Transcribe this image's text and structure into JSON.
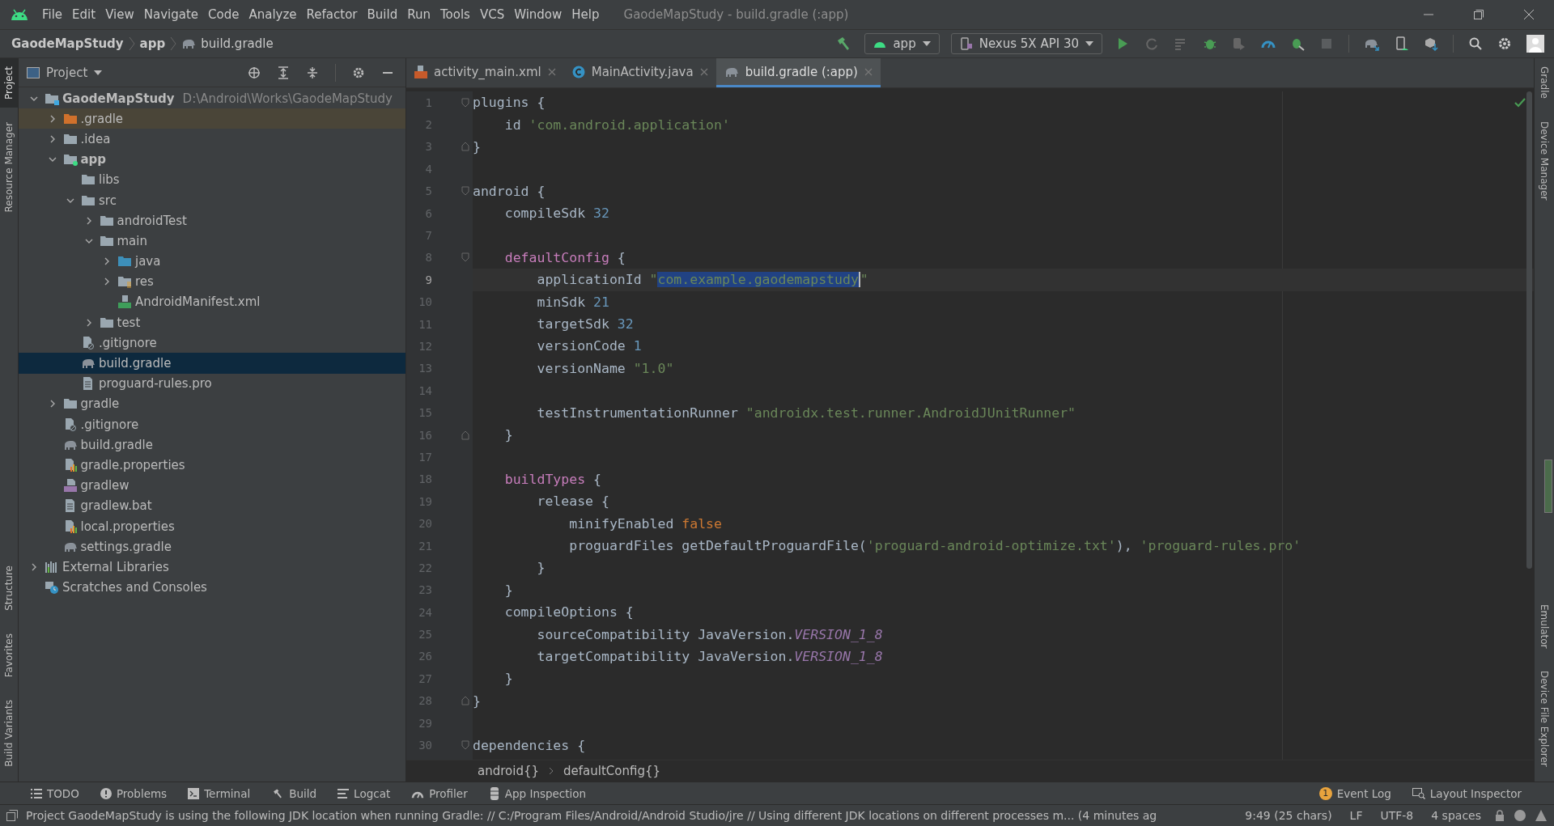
{
  "menu_bar": {
    "items": [
      "File",
      "Edit",
      "View",
      "Navigate",
      "Code",
      "Analyze",
      "Refactor",
      "Build",
      "Run",
      "Tools",
      "VCS",
      "Window",
      "Help"
    ],
    "title": "GaodeMapStudy - build.gradle (:app)"
  },
  "navigation_bar": {
    "breadcrumbs": [
      "GaodeMapStudy",
      "app",
      "build.gradle"
    ],
    "run_config": "app",
    "device": "Nexus 5X API 30"
  },
  "left_tool_tabs": [
    {
      "label": "Project",
      "selected": true,
      "kind": "top"
    },
    {
      "label": "Resource Manager",
      "selected": false,
      "kind": "top"
    },
    {
      "label": "Structure",
      "selected": false,
      "kind": "bottom"
    },
    {
      "label": "Favorites",
      "selected": false,
      "kind": "bottom"
    },
    {
      "label": "Build Variants",
      "selected": false,
      "kind": "bottom"
    }
  ],
  "right_tool_tabs": [
    {
      "label": "Gradle",
      "kind": "top"
    },
    {
      "label": "Device Manager",
      "kind": "top"
    },
    {
      "label": "Emulator",
      "kind": "bottom"
    },
    {
      "label": "Device File Explorer",
      "kind": "bottom"
    }
  ],
  "project_panel": {
    "title": "Project",
    "tree": [
      {
        "name": "GaodeMapStudy",
        "hint": "D:\\Android\\Works\\GaodeMapStudy",
        "kind": "project",
        "expanded": true,
        "selected": false,
        "children": [
          {
            "name": ".gradle",
            "kind": "excluded",
            "expanded": false,
            "selected": false
          },
          {
            "name": ".idea",
            "kind": "folder",
            "expanded": false,
            "selected": false
          },
          {
            "name": "app",
            "kind": "module",
            "expanded": true,
            "selected": false,
            "children": [
              {
                "name": "libs",
                "kind": "folder",
                "selected": false
              },
              {
                "name": "src",
                "kind": "folder",
                "expanded": true,
                "selected": false,
                "children": [
                  {
                    "name": "androidTest",
                    "kind": "folder",
                    "expanded": false,
                    "selected": false
                  },
                  {
                    "name": "main",
                    "kind": "folder",
                    "expanded": true,
                    "selected": false,
                    "children": [
                      {
                        "name": "java",
                        "kind": "source",
                        "expanded": false,
                        "selected": false
                      },
                      {
                        "name": "res",
                        "kind": "res",
                        "expanded": false,
                        "selected": false
                      },
                      {
                        "name": "AndroidManifest.xml",
                        "kind": "manifest",
                        "selected": false
                      }
                    ]
                  },
                  {
                    "name": "test",
                    "kind": "folder",
                    "expanded": false,
                    "selected": false
                  }
                ]
              },
              {
                "name": ".gitignore",
                "kind": "ignore",
                "selected": false
              },
              {
                "name": "build.gradle",
                "kind": "gradle",
                "selected": true
              },
              {
                "name": "proguard-rules.pro",
                "kind": "text",
                "selected": false
              }
            ]
          },
          {
            "name": "gradle",
            "kind": "folder",
            "expanded": false,
            "selected": false
          },
          {
            "name": ".gitignore",
            "kind": "ignore",
            "selected": false
          },
          {
            "name": "build.gradle",
            "kind": "gradle",
            "selected": false
          },
          {
            "name": "gradle.properties",
            "kind": "properties",
            "selected": false
          },
          {
            "name": "gradlew",
            "kind": "shell",
            "selected": false
          },
          {
            "name": "gradlew.bat",
            "kind": "text",
            "selected": false
          },
          {
            "name": "local.properties",
            "kind": "properties",
            "selected": false
          },
          {
            "name": "settings.gradle",
            "kind": "gradle",
            "selected": false
          }
        ]
      },
      {
        "name": "External Libraries",
        "kind": "libraries",
        "expanded": false,
        "selected": false
      },
      {
        "name": "Scratches and Consoles",
        "kind": "scratches",
        "selected": false
      }
    ]
  },
  "editor_tabs": [
    {
      "label": "activity_main.xml",
      "kind": "xml",
      "selected": false
    },
    {
      "label": "MainActivity.java",
      "kind": "java",
      "selected": false
    },
    {
      "label": "build.gradle (:app)",
      "kind": "gradle",
      "selected": true
    }
  ],
  "editor": {
    "lines": [
      {
        "number": "1",
        "kind": "fold_start",
        "current": false,
        "tokens": [
          {
            "text": "plugins {",
            "kind": "plain"
          }
        ]
      },
      {
        "number": "2",
        "current": false,
        "tokens": [
          {
            "text": "    id ",
            "kind": "plain"
          },
          {
            "text": "'com.android.application'",
            "kind": "string"
          }
        ]
      },
      {
        "number": "3",
        "kind": "fold_end",
        "current": false,
        "tokens": [
          {
            "text": "}",
            "kind": "plain"
          }
        ]
      },
      {
        "number": "4",
        "current": false
      },
      {
        "number": "5",
        "kind": "fold_start",
        "current": false,
        "tokens": [
          {
            "text": "android {",
            "kind": "plain"
          }
        ]
      },
      {
        "number": "6",
        "current": false,
        "tokens": [
          {
            "text": "    compileSdk ",
            "kind": "plain"
          },
          {
            "text": "32",
            "kind": "number"
          }
        ]
      },
      {
        "number": "7",
        "current": false
      },
      {
        "number": "8",
        "kind": "fold_start",
        "current": false,
        "tokens": [
          {
            "text": "    defaultConfig",
            "kind": "block"
          },
          {
            "text": " {",
            "kind": "plain"
          }
        ]
      },
      {
        "number": "9",
        "current": true,
        "tokens": [
          {
            "text": "        applicationId ",
            "kind": "plain"
          },
          {
            "text": "\"",
            "kind": "string"
          },
          {
            "text": "com.example.gaodemapstudy",
            "kind": "string",
            "selected": true
          },
          {
            "text": "\"",
            "kind": "string"
          }
        ]
      },
      {
        "number": "10",
        "current": false,
        "tokens": [
          {
            "text": "        minSdk ",
            "kind": "plain"
          },
          {
            "text": "21",
            "kind": "number"
          }
        ]
      },
      {
        "number": "11",
        "current": false,
        "tokens": [
          {
            "text": "        targetSdk ",
            "kind": "plain"
          },
          {
            "text": "32",
            "kind": "number"
          }
        ]
      },
      {
        "number": "12",
        "current": false,
        "tokens": [
          {
            "text": "        versionCode ",
            "kind": "plain"
          },
          {
            "text": "1",
            "kind": "number"
          }
        ]
      },
      {
        "number": "13",
        "current": false,
        "tokens": [
          {
            "text": "        versionName ",
            "kind": "plain"
          },
          {
            "text": "\"1.0\"",
            "kind": "string"
          }
        ]
      },
      {
        "number": "14",
        "current": false
      },
      {
        "number": "15",
        "current": false,
        "tokens": [
          {
            "text": "        testInstrumentationRunner ",
            "kind": "plain"
          },
          {
            "text": "\"androidx.test.runner.AndroidJUnitRunner\"",
            "kind": "string"
          }
        ]
      },
      {
        "number": "16",
        "kind": "fold_end",
        "current": false,
        "tokens": [
          {
            "text": "    }",
            "kind": "plain"
          }
        ]
      },
      {
        "number": "17",
        "current": false
      },
      {
        "number": "18",
        "current": false,
        "tokens": [
          {
            "text": "    buildTypes",
            "kind": "block"
          },
          {
            "text": " {",
            "kind": "plain"
          }
        ]
      },
      {
        "number": "19",
        "current": false,
        "tokens": [
          {
            "text": "        release {",
            "kind": "plain"
          }
        ]
      },
      {
        "number": "20",
        "current": false,
        "tokens": [
          {
            "text": "            minifyEnabled ",
            "kind": "plain"
          },
          {
            "text": "false",
            "kind": "keyword"
          }
        ]
      },
      {
        "number": "21",
        "current": false,
        "tokens": [
          {
            "text": "            proguardFiles getDefaultProguardFile(",
            "kind": "plain"
          },
          {
            "text": "'proguard-android-optimize.txt'",
            "kind": "string"
          },
          {
            "text": "), ",
            "kind": "plain"
          },
          {
            "text": "'proguard-rules.pro'",
            "kind": "string"
          }
        ]
      },
      {
        "number": "22",
        "current": false,
        "tokens": [
          {
            "text": "        }",
            "kind": "plain"
          }
        ]
      },
      {
        "number": "23",
        "current": false,
        "tokens": [
          {
            "text": "    }",
            "kind": "plain"
          }
        ]
      },
      {
        "number": "24",
        "current": false,
        "tokens": [
          {
            "text": "    compileOptions {",
            "kind": "plain"
          }
        ]
      },
      {
        "number": "25",
        "current": false,
        "tokens": [
          {
            "text": "        sourceCompatibility JavaVersion.",
            "kind": "plain"
          },
          {
            "text": "VERSION_1_8",
            "kind": "constant"
          }
        ]
      },
      {
        "number": "26",
        "current": false,
        "tokens": [
          {
            "text": "        targetCompatibility JavaVersion.",
            "kind": "plain"
          },
          {
            "text": "VERSION_1_8",
            "kind": "constant"
          }
        ]
      },
      {
        "number": "27",
        "current": false,
        "tokens": [
          {
            "text": "    }",
            "kind": "plain"
          }
        ]
      },
      {
        "number": "28",
        "kind": "fold_end",
        "current": false,
        "tokens": [
          {
            "text": "}",
            "kind": "plain"
          }
        ]
      },
      {
        "number": "29",
        "current": false
      },
      {
        "number": "30",
        "kind": "fold_start",
        "current": false,
        "tokens": [
          {
            "text": "dependencies {",
            "kind": "plain"
          }
        ]
      }
    ],
    "breadcrumbs": [
      "android{}",
      "defaultConfig{}"
    ]
  },
  "tool_window_bar": {
    "left": [
      {
        "label": "TODO",
        "kind": "list"
      },
      {
        "label": "Problems",
        "kind": "problems"
      },
      {
        "label": "Terminal",
        "kind": "terminal"
      },
      {
        "label": "Build",
        "kind": "build"
      },
      {
        "label": "Logcat",
        "kind": "logcat"
      },
      {
        "label": "Profiler",
        "kind": "profiler"
      },
      {
        "label": "App Inspection",
        "kind": "inspection"
      }
    ],
    "right": [
      {
        "label": "Event Log",
        "badge": "1",
        "kind": "log"
      },
      {
        "label": "Layout Inspector",
        "kind": "layout"
      }
    ]
  },
  "status_bar": {
    "message": "Project GaodeMapStudy is using the following JDK location when running Gradle: // C:/Program Files/Android/Android Studio/jre // Using different JDK locations on different processes m... (4 minutes ag",
    "position": "9:49 (25 chars)",
    "line_separator": "LF",
    "encoding": "UTF-8",
    "indent": "4 spaces"
  }
}
